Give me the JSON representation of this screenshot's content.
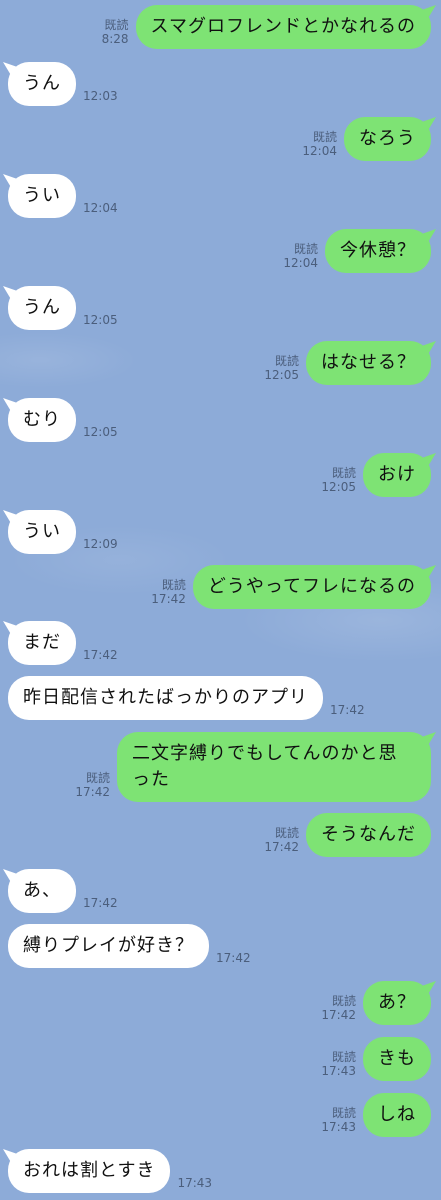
{
  "read_label": "既読",
  "messages": [
    {
      "dir": "out",
      "text": "スマグロフレンドとかなれるの",
      "time": "8:28",
      "read": true
    },
    {
      "dir": "in",
      "text": "うん",
      "time": "12:03"
    },
    {
      "dir": "out",
      "text": "なろう",
      "time": "12:04",
      "read": true
    },
    {
      "dir": "in",
      "text": "うい",
      "time": "12:04"
    },
    {
      "dir": "out",
      "text": "今休憩？",
      "time": "12:04",
      "read": true
    },
    {
      "dir": "in",
      "text": "うん",
      "time": "12:05"
    },
    {
      "dir": "out",
      "text": "はなせる？",
      "time": "12:05",
      "read": true
    },
    {
      "dir": "in",
      "text": "むり",
      "time": "12:05"
    },
    {
      "dir": "out",
      "text": "おけ",
      "time": "12:05",
      "read": true
    },
    {
      "dir": "in",
      "text": "うい",
      "time": "12:09"
    },
    {
      "dir": "out",
      "text": "どうやってフレになるの",
      "time": "17:42",
      "read": true
    },
    {
      "dir": "in",
      "text": "まだ",
      "time": "17:42"
    },
    {
      "dir": "in",
      "text": "昨日配信されたばっかりのアプリ",
      "time": "17:42"
    },
    {
      "dir": "out",
      "text": "二文字縛りでもしてんのかと思った",
      "time": "17:42",
      "read": true
    },
    {
      "dir": "out",
      "text": "そうなんだ",
      "time": "17:42",
      "read": true
    },
    {
      "dir": "in",
      "text": "あ、",
      "time": "17:42"
    },
    {
      "dir": "in",
      "text": "縛りプレイが好き？",
      "time": "17:42"
    },
    {
      "dir": "out",
      "text": "あ？",
      "time": "17:42",
      "read": true
    },
    {
      "dir": "out",
      "text": "きも",
      "time": "17:43",
      "read": true
    },
    {
      "dir": "out",
      "text": "しね",
      "time": "17:43",
      "read": true
    },
    {
      "dir": "in",
      "text": "おれは割とすき",
      "time": "17:43"
    }
  ]
}
